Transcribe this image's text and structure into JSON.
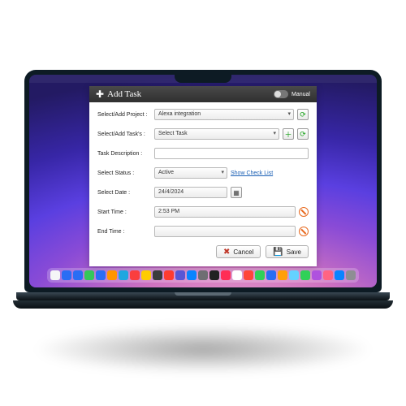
{
  "modal": {
    "title": "Add Task",
    "manual_label": "Manual",
    "rows": {
      "project": {
        "label": "Select/Add Project :",
        "value": "Alexa integration"
      },
      "task": {
        "label": "Select/Add Task's :",
        "value": "Select Task"
      },
      "desc": {
        "label": "Task Description :",
        "value": ""
      },
      "status": {
        "label": "Select Status :",
        "value": "Active",
        "link": "Show Check List"
      },
      "date": {
        "label": "Select Date :",
        "value": "24/4/2024"
      },
      "start": {
        "label": "Start Time :",
        "value": "2:53 PM"
      },
      "end": {
        "label": "End Time :",
        "value": ""
      }
    },
    "buttons": {
      "cancel": "Cancel",
      "save": "Save"
    }
  },
  "dock_colors": [
    "#f5f5f7",
    "#2a6df4",
    "#2a6df4",
    "#34c759",
    "#2a6df4",
    "#ff9500",
    "#1ea7e0",
    "#fa3e3e",
    "#ffcc00",
    "#3b3b3d",
    "#ff3b30",
    "#5856d6",
    "#0a84ff",
    "#6e6e73",
    "#222222",
    "#ff2d55",
    "#ffffff",
    "#ff453a",
    "#30d158",
    "#2a6df4",
    "#ff9f0a",
    "#64d2ff",
    "#30d158",
    "#af52de",
    "#ff6482",
    "#0a84ff",
    "#8e8e93"
  ]
}
